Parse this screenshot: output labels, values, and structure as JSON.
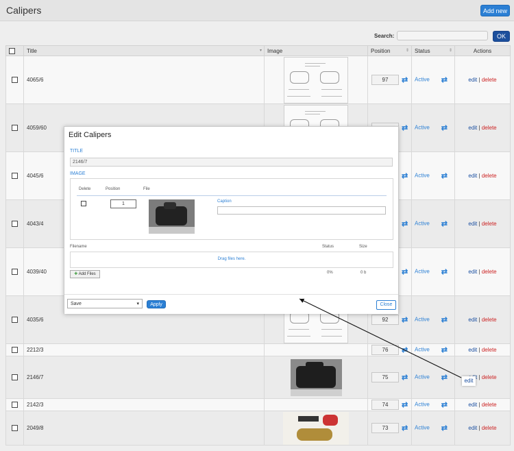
{
  "header": {
    "title": "Calipers",
    "add_new_label": "Add new"
  },
  "search": {
    "label": "Search:",
    "ok_label": "OK",
    "value": ""
  },
  "table": {
    "columns": {
      "title": "Title",
      "image": "Image",
      "position": "Position",
      "status": "Status",
      "actions": "Actions"
    },
    "rows": [
      {
        "title": "4065/6",
        "position": "97",
        "status": "Active",
        "image": "drawing"
      },
      {
        "title": "4059/60",
        "position": "",
        "status": "Active",
        "image": "drawing"
      },
      {
        "title": "4045/6",
        "position": "",
        "status": "Active",
        "image": "drawing"
      },
      {
        "title": "4043/4",
        "position": "",
        "status": "Active",
        "image": "drawing"
      },
      {
        "title": "4039/40",
        "position": "",
        "status": "Active",
        "image": "drawing"
      },
      {
        "title": "4035/6",
        "position": "92",
        "status": "Active",
        "image": "drawing"
      },
      {
        "title": "2212/3",
        "position": "76",
        "status": "Active",
        "image": "none"
      },
      {
        "title": "2146/7",
        "position": "75",
        "status": "Active",
        "image": "photo"
      },
      {
        "title": "2142/3",
        "position": "74",
        "status": "Active",
        "image": "none"
      },
      {
        "title": "2049/8",
        "position": "73",
        "status": "Active",
        "image": "logo"
      }
    ],
    "edit_label": "edit",
    "separator": "|",
    "delete_label": "delete"
  },
  "modal": {
    "title": "Edit Calipers",
    "title_section": "TITLE",
    "title_value": "2146/7",
    "image_section": "IMAGE",
    "image_table": {
      "delete_header": "Delete",
      "position_header": "Position",
      "file_header": "File",
      "position_value": "1",
      "caption_label": "Caption",
      "caption_value": ""
    },
    "uploader": {
      "filename_header": "Filename",
      "status_header": "Status",
      "size_header": "Size",
      "drop_text": "Drag files here.",
      "add_files_label": "Add Files",
      "percent": "0%",
      "size": "0 b"
    },
    "footer": {
      "save_option": "Save",
      "apply_label": "Apply",
      "close_label": "Close"
    }
  },
  "highlight": {
    "edit_label": "edit"
  },
  "colors": {
    "accent": "#2b7fd4",
    "ok_button": "#1c4f9c",
    "delete": "#cc2222"
  }
}
